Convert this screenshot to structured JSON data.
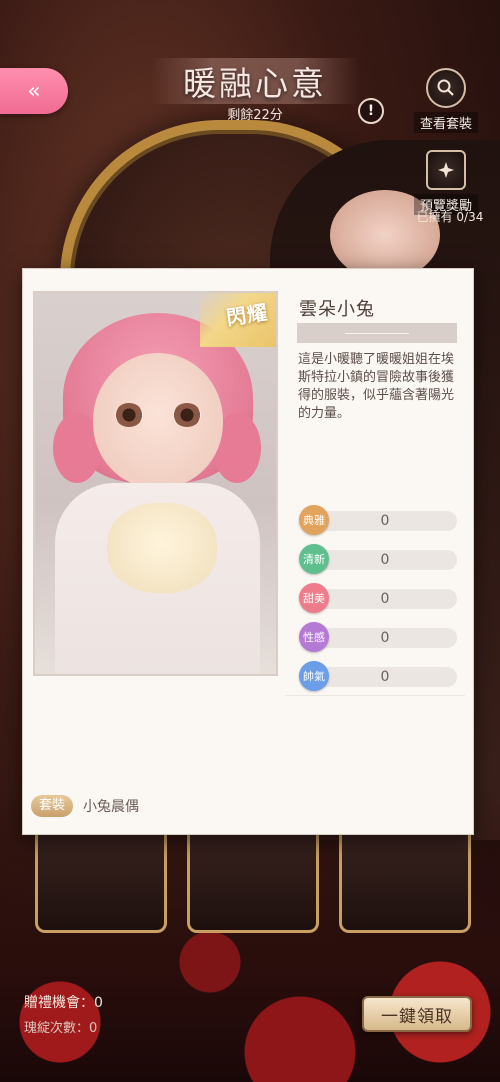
{
  "header": {
    "back_icon": "«",
    "title": "暖融心意",
    "remaining": "剩餘22分",
    "info_icon": "!"
  },
  "side_buttons": {
    "view_suit": {
      "icon": "search-icon",
      "label": "查看套裝"
    },
    "preview_rewards": {
      "icon": "reward-icon",
      "label": "預覽獎勵"
    },
    "owned": "已擁有 0/34"
  },
  "card": {
    "badge": "閃耀",
    "name": "雲朵小兔",
    "description": "這是小暖聽了暖暖姐姐在埃斯特拉小鎮的冒險故事後獲得的服裝，似乎蘊含著陽光的力量。",
    "stats": [
      {
        "label": "典雅",
        "value": "0",
        "color": "#e2a35c"
      },
      {
        "label": "清新",
        "value": "0",
        "color": "#5fbf8e"
      },
      {
        "label": "甜美",
        "value": "0",
        "color": "#ef7b8b"
      },
      {
        "label": "性感",
        "value": "0",
        "color": "#b57ad6"
      },
      {
        "label": "帥氣",
        "value": "0",
        "color": "#6a9ee8"
      }
    ],
    "tag": "套裝",
    "suit_name": "小兔晨偶"
  },
  "footer": {
    "gift_chances": "贈禮機會：0",
    "rose_count": "瑰綻次數：0",
    "claim_all": "一鍵領取"
  }
}
